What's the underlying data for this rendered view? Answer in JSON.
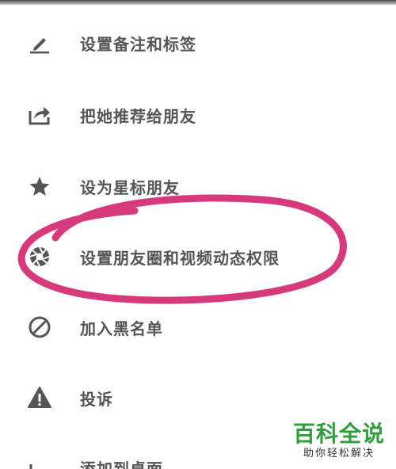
{
  "menu": {
    "items": [
      {
        "label": "设置备注和标签",
        "icon": "pencil-icon"
      },
      {
        "label": "把她推荐给朋友",
        "icon": "share-icon"
      },
      {
        "label": "设为星标朋友",
        "icon": "star-icon"
      },
      {
        "label": "设置朋友圈和视频动态权限",
        "icon": "aperture-icon"
      },
      {
        "label": "加入黑名单",
        "icon": "block-icon"
      },
      {
        "label": "投诉",
        "icon": "warning-icon"
      },
      {
        "label": "添加到桌面",
        "icon": "add-to-desktop-icon"
      }
    ]
  },
  "watermark": {
    "title": "百科全说",
    "subtitle": "助你轻松解决"
  },
  "colors": {
    "text": "#555555",
    "icon": "#555555",
    "highlight": "#d63a7c",
    "watermark_green": "#2e9e3a"
  }
}
